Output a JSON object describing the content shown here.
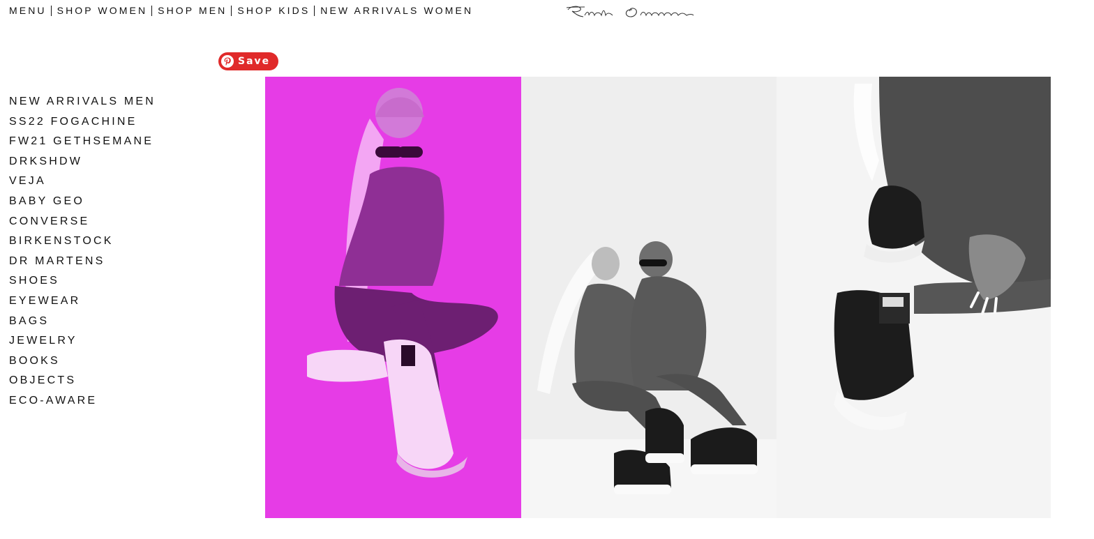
{
  "topnav": {
    "items": [
      {
        "label": "MENU"
      },
      {
        "label": "SHOP WOMEN"
      },
      {
        "label": "SHOP MEN"
      },
      {
        "label": "SHOP KIDS"
      },
      {
        "label": "NEW ARRIVALS WOMEN"
      }
    ]
  },
  "logo": {
    "text": "Rick Owens"
  },
  "pin_button": {
    "label": "Save",
    "icon": "pinterest-icon",
    "color": "#e02a2a"
  },
  "sidebar": {
    "items": [
      {
        "label": "NEW ARRIVALS MEN"
      },
      {
        "label": "SS22 FOGACHINE"
      },
      {
        "label": "FW21 GETHSEMANE"
      },
      {
        "label": "DRKSHDW"
      },
      {
        "label": "VEJA"
      },
      {
        "label": "BABY GEO"
      },
      {
        "label": "CONVERSE"
      },
      {
        "label": "BIRKENSTOCK"
      },
      {
        "label": "DR MARTENS"
      },
      {
        "label": "SHOES"
      },
      {
        "label": "EYEWEAR"
      },
      {
        "label": "BAGS"
      },
      {
        "label": "JEWELRY"
      },
      {
        "label": "BOOKS"
      },
      {
        "label": "OBJECTS"
      },
      {
        "label": "ECO-AWARE"
      }
    ]
  },
  "gallery": {
    "colors": {
      "magenta": "#e63ce6",
      "grey_bg": "#eeeeee",
      "white_bg": "#f4f4f4"
    }
  }
}
